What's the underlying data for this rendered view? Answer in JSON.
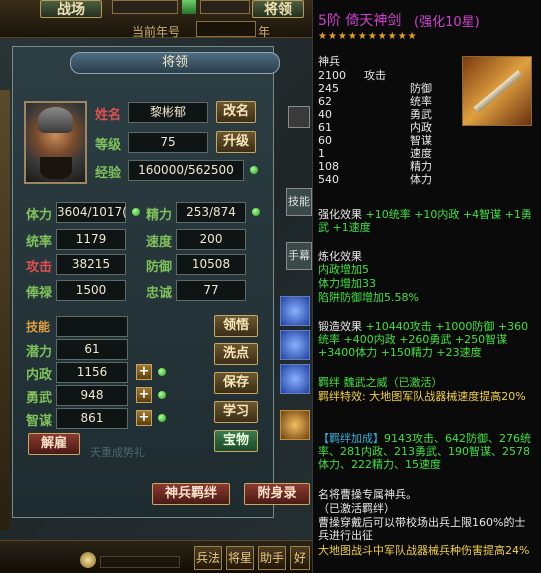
{
  "topbar": {
    "tab_left": "战场",
    "tab_right": "将领",
    "year_label": "当前年号",
    "year_suffix": "年"
  },
  "panel": {
    "title": "将领",
    "name_label": "姓名",
    "name_value": "黎彬郁",
    "rename_button": "改名",
    "level_label": "等级",
    "level_value": "75",
    "upgrade_button": "升级",
    "exp_label": "经验",
    "exp_value": "160000/562500",
    "stats": {
      "stamina_label": "体力",
      "stamina_value": "3604/1017(",
      "vigor_label": "精力",
      "vigor_value": "253/874",
      "command_label": "统率",
      "command_value": "1179",
      "speed_label": "速度",
      "speed_value": "200",
      "attack_label": "攻击",
      "attack_value": "38215",
      "defense_label": "防御",
      "defense_value": "10508",
      "salary_label": "俸禄",
      "salary_value": "1500",
      "loyalty_label": "忠诚",
      "loyalty_value": "77"
    },
    "skill_label": "技能",
    "skill_value": "",
    "learn_skill_button": "领悟",
    "potential_label": "潜力",
    "potential_value": "61",
    "politics_label": "内政",
    "politics_value": "1156",
    "bravery_label": "勇武",
    "bravery_value": "948",
    "wisdom_label": "智谋",
    "wisdom_value": "861",
    "reset_points_button": "洗点",
    "save_button": "保存",
    "study_button": "学习",
    "treasure_button": "宝物",
    "dismiss_button": "解雇",
    "faded_text": "天重成势礼",
    "bond_button": "神兵羁绊",
    "attach_button": "附身录"
  },
  "sidebar": {
    "tab1": "技能",
    "tab2": "手幕"
  },
  "bottombar": {
    "soldiers": "兵法",
    "generals": "将星",
    "helper": "助手",
    "friends": "好友"
  },
  "tooltip": {
    "title": "5阶 倚天神剑",
    "enhance": "(强化10星)",
    "stars": "★★★★★★★★★★",
    "category": "神兵",
    "attrs": [
      {
        "value": "2100",
        "name": "攻击"
      },
      {
        "value": "245",
        "name": "防御"
      },
      {
        "value": "62",
        "name": "统率"
      },
      {
        "value": "40",
        "name": "勇武"
      },
      {
        "value": "61",
        "name": "内政"
      },
      {
        "value": "60",
        "name": "智谋"
      },
      {
        "value": "1",
        "name": "速度"
      },
      {
        "value": "108",
        "name": "精力"
      },
      {
        "value": "540",
        "name": "体力"
      }
    ],
    "enhance_label": "强化效果",
    "enhance_effects": " +10统率 +10内政 +4智谋 +1勇武 +1速度",
    "refine_label": "炼化效果",
    "refine_1": "内政增加5",
    "refine_2": "体力增加33",
    "refine_3": "陷阱防御增加5.58%",
    "forge_label": "锻造效果",
    "forge_effects": " +10440攻击 +1000防御 +360统率 +400内政 +260勇武 +250智谋 +3400体力 +150精力 +23速度",
    "bond_title": "羁绊 魏武之威（已激活）",
    "bond_effect": "羁绊特效: 大地图军队战器械速度提高20%",
    "bond_bonus_label": "【羁绊加成】",
    "bond_bonus": "9143攻击、642防御、276统率、281内政、213勇武、190智谋、2578体力、222精力、15速度",
    "exclusive_1": "名将曹操专属神兵。",
    "exclusive_2": "（已激活羁绊）",
    "exclusive_3": "曹操穿戴后可以带校场出兵上限160%的士兵进行出征",
    "exclusive_4": "大地图战斗中军队战器械兵种伤害提高24%"
  }
}
